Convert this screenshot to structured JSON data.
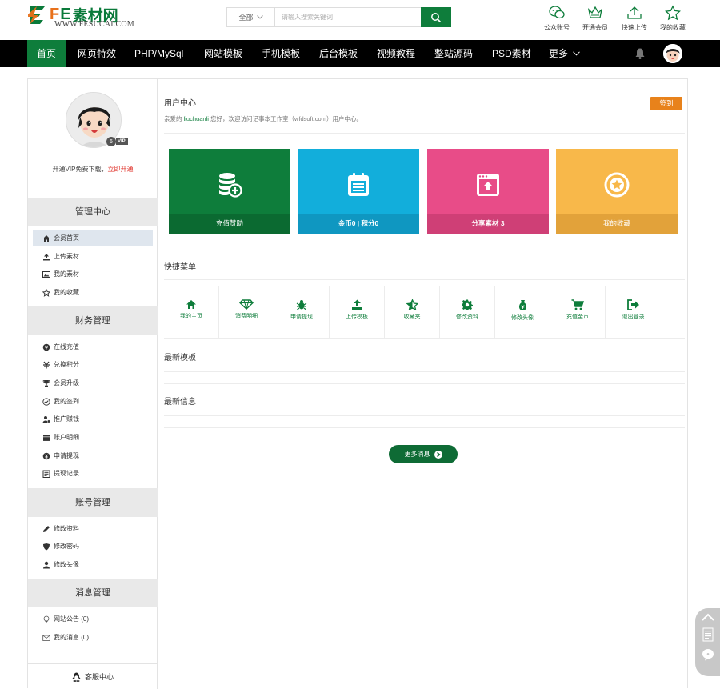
{
  "header": {
    "logo_main": "FE素材网",
    "logo_fe": "FE",
    "logo_cn": "素材网",
    "logo_sub": "WWW.FESUCAI.COM",
    "search": {
      "category": "全部",
      "placeholder": "请输入搜索关键词"
    },
    "tools": [
      {
        "label": "公众账号",
        "icon": "wechat-icon"
      },
      {
        "label": "开通会员",
        "icon": "crown-icon"
      },
      {
        "label": "快速上传",
        "icon": "upload-icon"
      },
      {
        "label": "我的收藏",
        "icon": "star-icon"
      }
    ]
  },
  "nav": {
    "items": [
      {
        "label": "首页",
        "active": true
      },
      {
        "label": "网页特效"
      },
      {
        "label": "PHP/MySql"
      },
      {
        "label": "网站模板"
      },
      {
        "label": "手机模板"
      },
      {
        "label": "后台模板"
      },
      {
        "label": "视频教程"
      },
      {
        "label": "整站源码"
      },
      {
        "label": "PSD素材"
      },
      {
        "label": "更多"
      }
    ],
    "more_arrow": "chevron-down-icon",
    "bell": "bell-icon"
  },
  "sidebar": {
    "vip_badge": "VIP",
    "vip_num": "6",
    "vip_text": "开通VIP免费下载，",
    "vip_link": "立即开通",
    "sections": [
      {
        "title": "管理中心",
        "items": [
          {
            "label": "会员首页",
            "icon": "home-icon",
            "active": true
          },
          {
            "label": "上传素材",
            "icon": "upload-icon"
          },
          {
            "label": "我的素材",
            "icon": "image-icon"
          },
          {
            "label": "我的收藏",
            "icon": "star-outline-icon"
          }
        ]
      },
      {
        "title": "财务管理",
        "items": [
          {
            "label": "在线充值",
            "icon": "coin-icon"
          },
          {
            "label": "兑换积分",
            "icon": "exchange-icon"
          },
          {
            "label": "会员升级",
            "icon": "trophy-icon"
          },
          {
            "label": "我的签到",
            "icon": "check-circle-icon"
          },
          {
            "label": "推广赚钱",
            "icon": "user-money-icon"
          },
          {
            "label": "账户明细",
            "icon": "list-icon"
          },
          {
            "label": "申请提现",
            "icon": "yen-icon"
          },
          {
            "label": "提现记录",
            "icon": "record-icon"
          }
        ]
      },
      {
        "title": "账号管理",
        "items": [
          {
            "label": "修改资料",
            "icon": "pencil-icon"
          },
          {
            "label": "修改密码",
            "icon": "shield-icon"
          },
          {
            "label": "修改头像",
            "icon": "user-icon"
          }
        ]
      },
      {
        "title": "消息管理",
        "items": [
          {
            "label": "网站公告 (0)",
            "icon": "bulb-icon"
          },
          {
            "label": "我的消息 (0)",
            "icon": "mail-icon"
          }
        ]
      }
    ],
    "kefu": "客服中心"
  },
  "main": {
    "title": "用户中心",
    "welcome_prefix": "亲爱的",
    "username": "liuchuanli",
    "welcome_suffix": "您好，欢迎访问记事本工作室（wfdsoft.com）用户中心。",
    "sign_btn": "签到",
    "cards": [
      {
        "label": "充值赞助",
        "color": "#0e7d3b",
        "label_bg": "#0b6a31",
        "icon": "coins-plus-icon"
      },
      {
        "label": "金币0 | 积分0",
        "color": "#12aedb",
        "label_bg": "#0f97c1",
        "icon": "calendar-icon"
      },
      {
        "label": "分享素材 3",
        "color": "#e84c88",
        "label_bg": "#cf3f76",
        "icon": "share-upload-icon"
      },
      {
        "label": "我的收藏",
        "color": "#f8b84a",
        "label_bg": "#e2a23a",
        "icon": "star-circle-icon"
      }
    ],
    "quick_title": "快捷菜单",
    "quick": [
      {
        "label": "我的主页",
        "icon": "home-icon"
      },
      {
        "label": "消费明细",
        "icon": "diamond-icon"
      },
      {
        "label": "申请提现",
        "icon": "bug-icon"
      },
      {
        "label": "上传模板",
        "icon": "upload-icon"
      },
      {
        "label": "收藏夹",
        "icon": "star-half-icon"
      },
      {
        "label": "修改资料",
        "icon": "gear-icon"
      },
      {
        "label": "修改头像",
        "icon": "moneybag-icon"
      },
      {
        "label": "充值金币",
        "icon": "cart-icon"
      },
      {
        "label": "退出登录",
        "icon": "logout-icon"
      }
    ],
    "latest_templates": "最新模板",
    "latest_info": "最新信息",
    "more_btn": "更多消息"
  },
  "colors": {
    "brand_green": "#0e7d3b",
    "nav_bg": "#000000",
    "sign_orange": "#e8821b"
  }
}
